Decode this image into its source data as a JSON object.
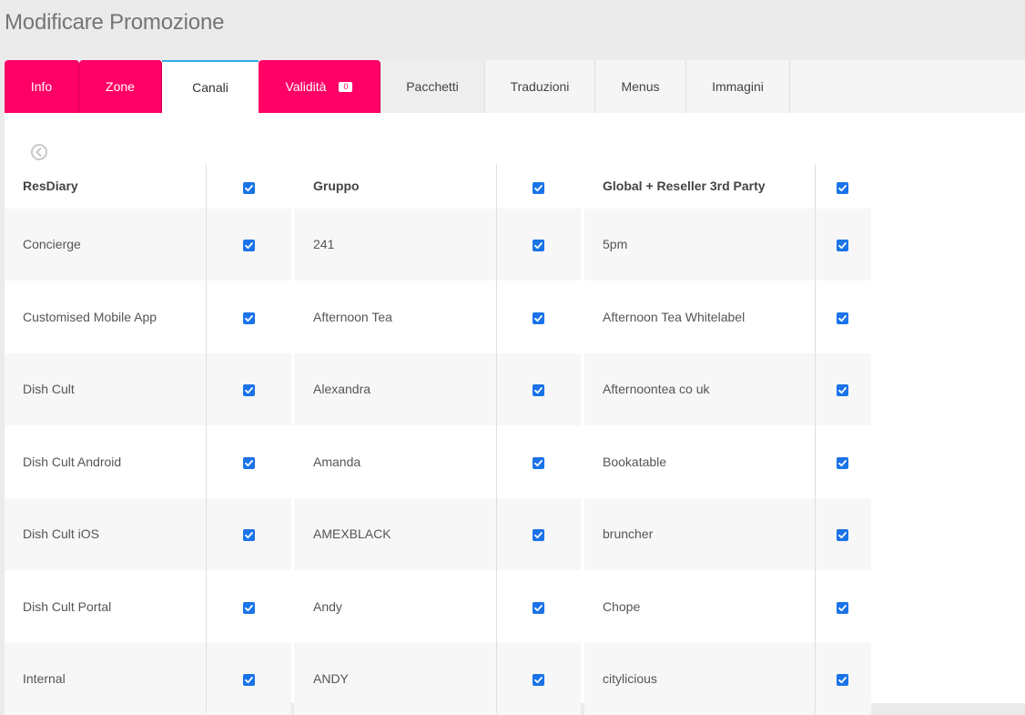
{
  "page": {
    "title": "Modificare Promozione"
  },
  "tabs": [
    {
      "label": "Info"
    },
    {
      "label": "Zone"
    },
    {
      "label": "Canali"
    },
    {
      "label": "Validità",
      "badge": "0"
    },
    {
      "label": "Pacchetti"
    },
    {
      "label": "Traduzioni"
    },
    {
      "label": "Menus"
    },
    {
      "label": "Immagini"
    }
  ],
  "colors": {
    "accent": "#ff0066",
    "active_tab_border": "#2eaee6",
    "checkbox": "#1a73e8"
  },
  "icons": {
    "back": "chevron-left-circle-icon",
    "check": "check-icon"
  },
  "table": {
    "headers": [
      "ResDiary",
      "Gruppo",
      "Global + Reseller 3rd Party"
    ],
    "header_checked": [
      true,
      true,
      true
    ],
    "rows": [
      {
        "col1": "Concierge",
        "col2": "241",
        "col3": "5pm",
        "checked": [
          true,
          true,
          true
        ]
      },
      {
        "col1": "Customised Mobile App",
        "col2": "Afternoon Tea",
        "col3": "Afternoon Tea Whitelabel",
        "checked": [
          true,
          true,
          true
        ]
      },
      {
        "col1": "Dish Cult",
        "col2": "Alexandra",
        "col3": "Afternoontea co uk",
        "checked": [
          true,
          true,
          true
        ]
      },
      {
        "col1": "Dish Cult Android",
        "col2": "Amanda",
        "col3": "Bookatable",
        "checked": [
          true,
          true,
          true
        ]
      },
      {
        "col1": "Dish Cult iOS",
        "col2": "AMEXBLACK",
        "col3": "bruncher",
        "checked": [
          true,
          true,
          true
        ]
      },
      {
        "col1": "Dish Cult Portal",
        "col2": "Andy",
        "col3": "Chope",
        "checked": [
          true,
          true,
          true
        ]
      },
      {
        "col1": "Internal",
        "col2": "ANDY",
        "col3": "citylicious",
        "checked": [
          true,
          true,
          true
        ]
      }
    ]
  }
}
